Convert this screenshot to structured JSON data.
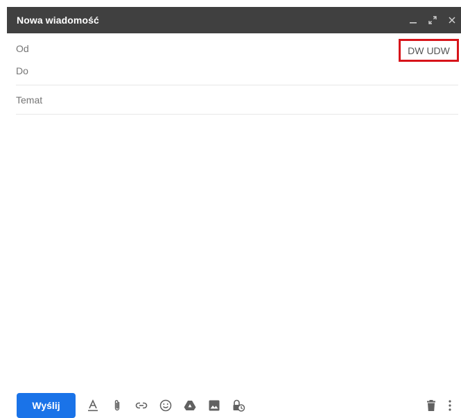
{
  "compose": {
    "title": "Nowa wiadomość",
    "controls": [
      {
        "name": "minimize",
        "icon": "minimize-icon"
      },
      {
        "name": "expand",
        "icon": "expand-icon"
      },
      {
        "name": "close",
        "icon": "close-icon"
      }
    ]
  },
  "fields": {
    "from_label": "Od",
    "to_label": "Do",
    "subject_label": "Temat",
    "cc_label": "DW",
    "bcc_label": "UDW"
  },
  "toolbar": {
    "send_label": "Wyślij",
    "tools": [
      "format-text-icon",
      "attach-icon",
      "link-icon",
      "emoji-icon",
      "drive-icon",
      "photo-icon",
      "confidential-mode-icon"
    ],
    "right_tools": [
      "trash-icon",
      "more-options-icon"
    ]
  },
  "colors": {
    "titlebar": "#404040",
    "send_button": "#1a73e8",
    "highlight_box": "#d7141a",
    "icon_gray": "#616161"
  }
}
